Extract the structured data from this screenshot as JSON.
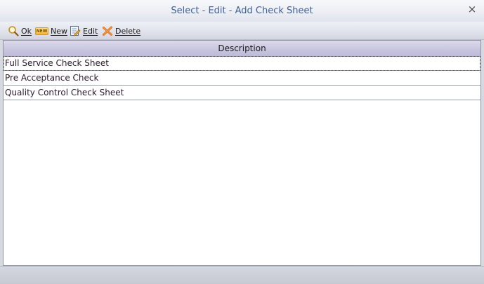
{
  "window": {
    "title": "Select - Edit - Add Check Sheet",
    "close_glyph": "×"
  },
  "toolbar": {
    "ok_label": "Ok",
    "new_label": "New",
    "new_badge": "NEW",
    "edit_label": "Edit",
    "delete_label": "Delete"
  },
  "grid": {
    "column_header": "Description",
    "rows": [
      "Full Service Check Sheet",
      "Pre Acceptance Check",
      "Quality Control Check Sheet"
    ]
  },
  "icons": {
    "ok": "magnifier-icon",
    "new": "new-badge-icon",
    "edit": "edit-document-icon",
    "delete": "delete-x-icon"
  },
  "colors": {
    "title_text": "#3f5f96",
    "header_bg": "#c9c6e0",
    "delete_icon": "#e0701a"
  }
}
